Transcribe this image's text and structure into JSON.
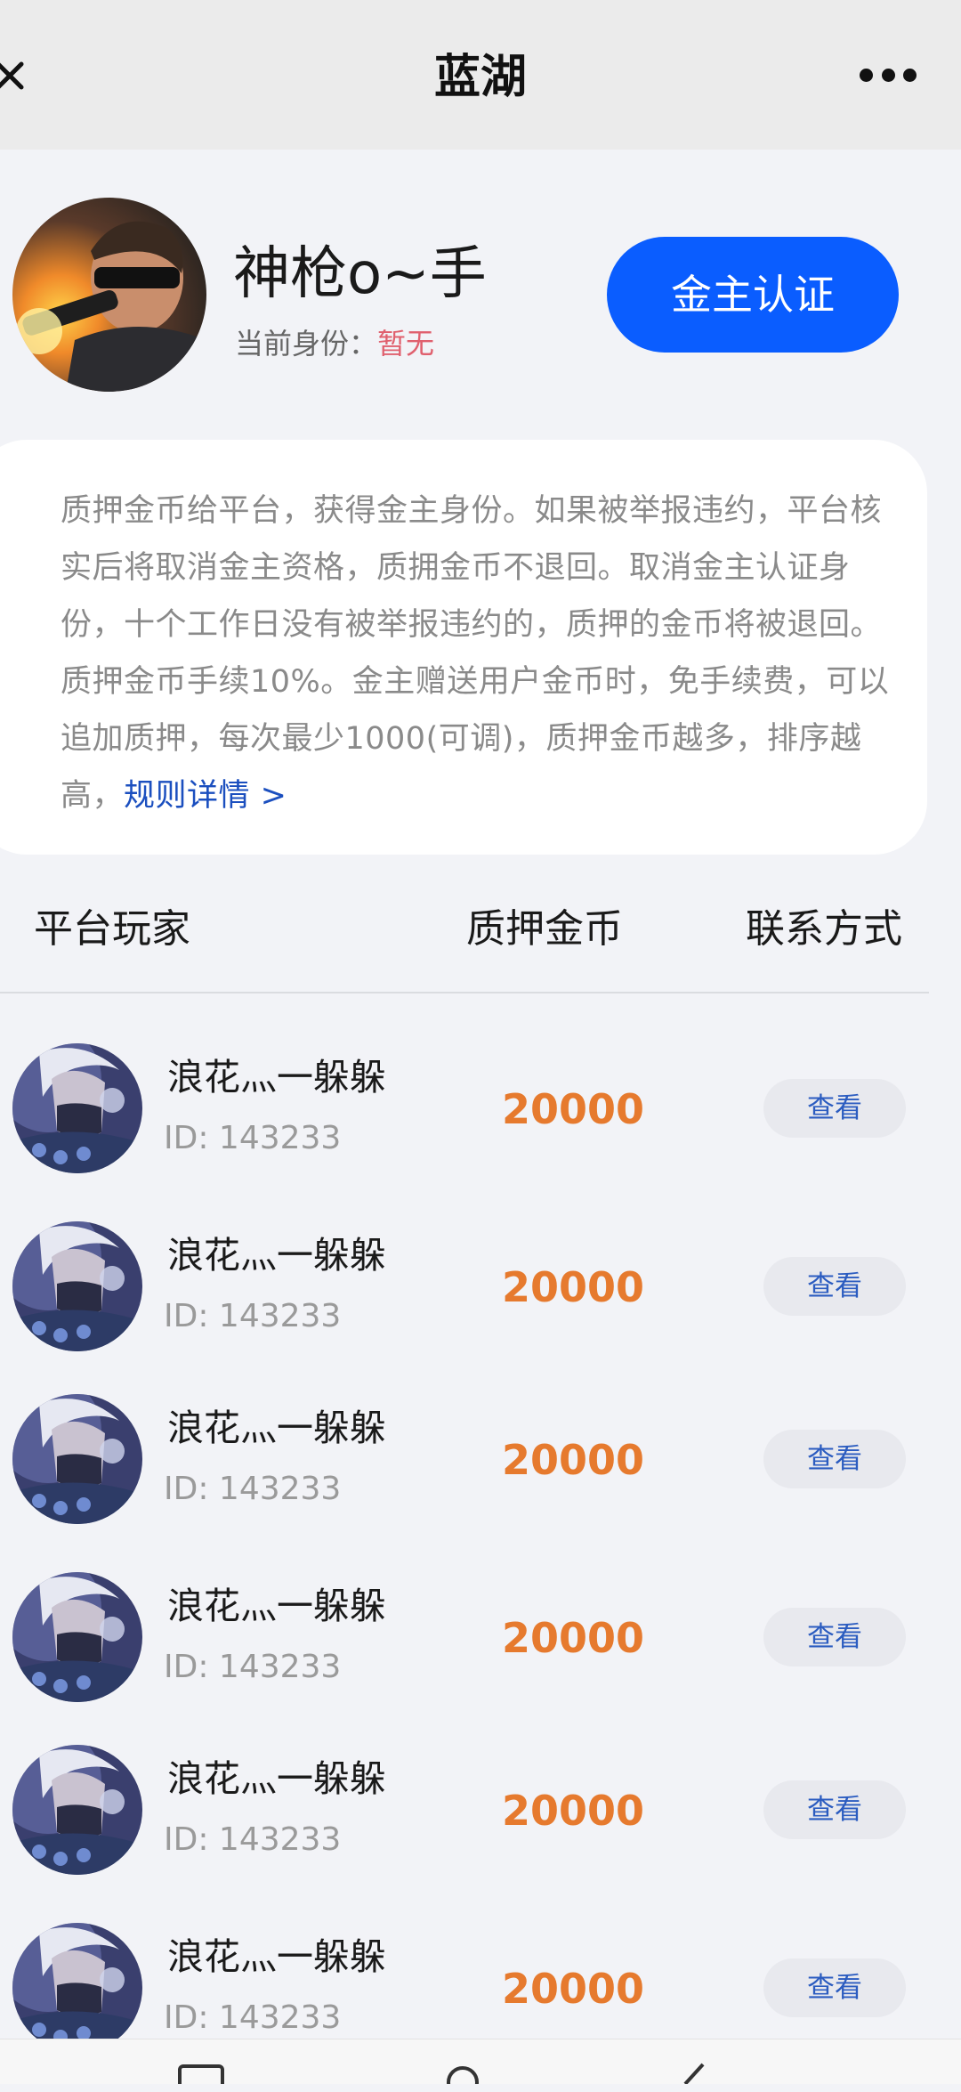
{
  "navbar": {
    "title": "蓝湖"
  },
  "profile": {
    "name": "神枪o~手",
    "identity_label": "当前身份：",
    "identity_value": "暂无",
    "gold_button_label": "金主认证"
  },
  "info": {
    "text": "质押金币给平台，获得金主身份。如果被举报违约，平台核实后将取消金主资格，质拥金币不退回。取消金主认证身份，十个工作日没有被举报违约的，质押的金币将被退回。质押金币手续10%。金主赠送用户金币时，免手续费，可以追加质押，每次最少1000(可调)，质押金币越多，排序越高，",
    "link_label": "规则详情 >"
  },
  "table": {
    "headers": {
      "player": "平台玩家",
      "coins": "质押金币",
      "contact": "联系方式"
    },
    "rows": [
      {
        "name": "浪花灬一躲躲",
        "id": "ID: 143233",
        "coins": "20000",
        "view_label": "查看"
      },
      {
        "name": "浪花灬一躲躲",
        "id": "ID: 143233",
        "coins": "20000",
        "view_label": "查看"
      },
      {
        "name": "浪花灬一躲躲",
        "id": "ID: 143233",
        "coins": "20000",
        "view_label": "查看"
      },
      {
        "name": "浪花灬一躲躲",
        "id": "ID: 143233",
        "coins": "20000",
        "view_label": "查看"
      },
      {
        "name": "浪花灬一躲躲",
        "id": "ID: 143233",
        "coins": "20000",
        "view_label": "查看"
      },
      {
        "name": "浪花灬一躲躲",
        "id": "ID: 143233",
        "coins": "20000",
        "view_label": "查看"
      }
    ]
  },
  "icons": {
    "back": "close-x-icon",
    "more": "more-dots-icon"
  },
  "colors": {
    "primary_button": "#0a5dff",
    "coins": "#e67a2e",
    "link": "#1b4fbf",
    "identity_value": "#e0606e",
    "page_background": "#f2f3f7",
    "navbar_background": "#ebebeb"
  }
}
